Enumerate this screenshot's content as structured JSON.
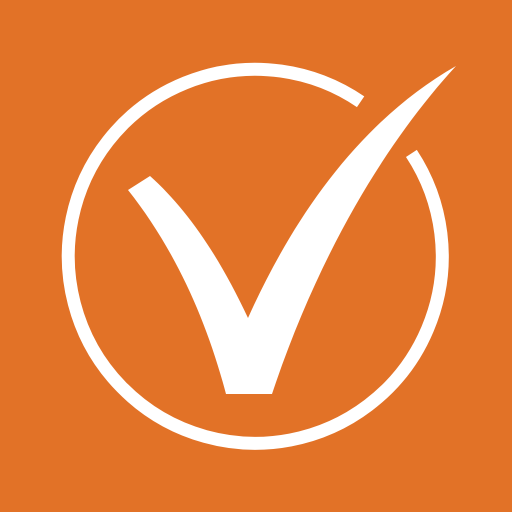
{
  "icon": {
    "name": "checkmark-in-circle-icon",
    "background_color": "#E27227",
    "foreground_color": "#FFFFFF"
  }
}
